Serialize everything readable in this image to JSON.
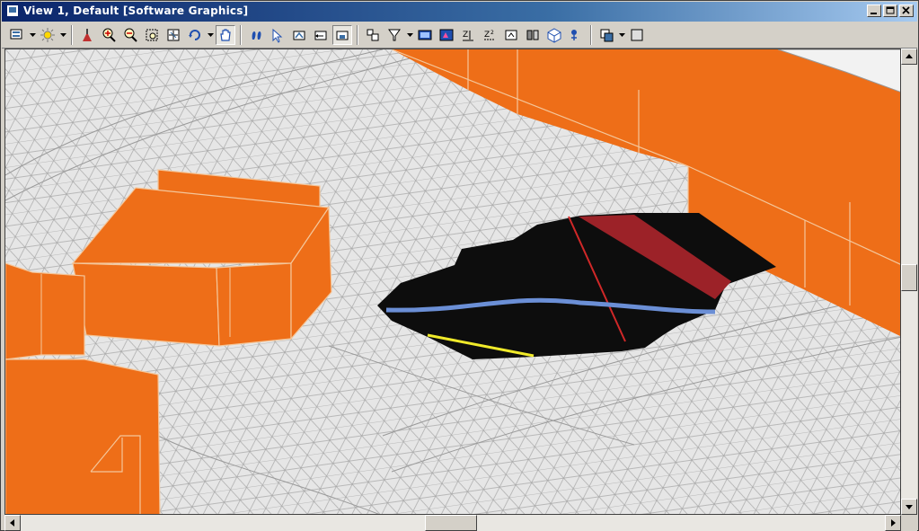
{
  "window": {
    "title": "View 1, Default [Software Graphics]",
    "controls": [
      "minimize",
      "maximize",
      "close"
    ]
  },
  "toolbar": {
    "tools": [
      {
        "name": "view-attributes-icon",
        "dropdown": true
      },
      {
        "name": "display-style-icon",
        "dropdown": true
      },
      {
        "name": "update-view-icon"
      },
      {
        "name": "zoom-in-icon"
      },
      {
        "name": "zoom-out-icon"
      },
      {
        "name": "window-area-icon"
      },
      {
        "name": "fit-view-icon"
      },
      {
        "name": "rotate-view-icon",
        "dropdown": true
      },
      {
        "name": "pan-view-icon",
        "active": true
      },
      {
        "name": "walk-icon"
      },
      {
        "name": "view-previous-icon"
      },
      {
        "name": "view-next-icon"
      },
      {
        "name": "apply-standard-view-icon"
      },
      {
        "name": "camera-icon",
        "active": true
      },
      {
        "name": "clip-volume-icon"
      },
      {
        "name": "clip-mask-icon",
        "dropdown": true
      },
      {
        "name": "display-set-icon"
      },
      {
        "name": "view-display-mode-icon"
      },
      {
        "name": "render-icon"
      },
      {
        "name": "z-front-icon"
      },
      {
        "name": "z-back-icon"
      },
      {
        "name": "view-rotation-icon"
      },
      {
        "name": "copy-view-icon"
      },
      {
        "name": "isometric-cube-icon"
      },
      {
        "name": "saved-views-icon",
        "dropdown": true
      },
      {
        "name": "view-groups-icon"
      }
    ]
  },
  "colors": {
    "terrain": "#e6e6e6",
    "mesh": "#a9a9a9",
    "building": "#ee6e18",
    "excavation": "#0d0d0d",
    "blue_line": "#6b8fd6",
    "red_band": "#9c2228",
    "red_line": "#d02828",
    "yellow_line": "#f0ea2a"
  },
  "scrollbars": {
    "vertical_position": 0.5,
    "horizontal_position": 0.5
  }
}
